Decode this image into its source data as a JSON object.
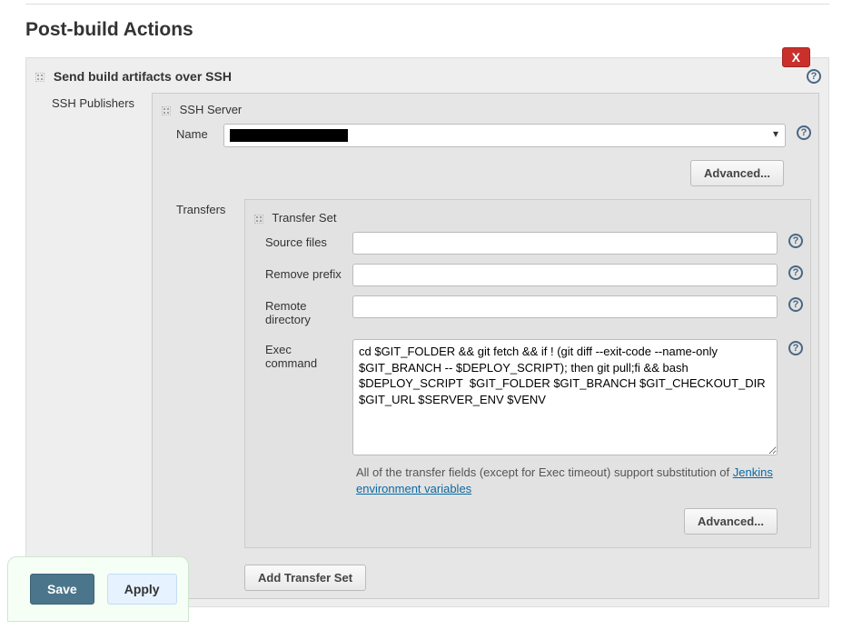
{
  "section_title": "Post-build Actions",
  "publisher_title": "Send build artifacts over SSH",
  "close_label": "X",
  "ssh_publishers_label": "SSH Publishers",
  "ssh_server_label": "SSH Server",
  "name_label": "Name",
  "advanced_label": "Advanced...",
  "transfers_label": "Transfers",
  "transfer_set_label": "Transfer Set",
  "source_files_label": "Source files",
  "remove_prefix_label": "Remove prefix",
  "remote_directory_label": "Remote directory",
  "exec_command_label": "Exec command",
  "exec_command_value": "cd $GIT_FOLDER && git fetch && if ! (git diff --exit-code --name-only $GIT_BRANCH -- $DEPLOY_SCRIPT); then git pull;fi && bash $DEPLOY_SCRIPT  $GIT_FOLDER $GIT_BRANCH $GIT_CHECKOUT_DIR $GIT_URL $SERVER_ENV $VENV",
  "hint_prefix": "All of the transfer fields (except for Exec timeout) support substitution of ",
  "hint_link": "Jenkins environment variables",
  "add_transfer_set_label": "Add Transfer Set",
  "save_label": "Save",
  "apply_label": "Apply",
  "source_files_value": "",
  "remove_prefix_value": "",
  "remote_directory_value": ""
}
